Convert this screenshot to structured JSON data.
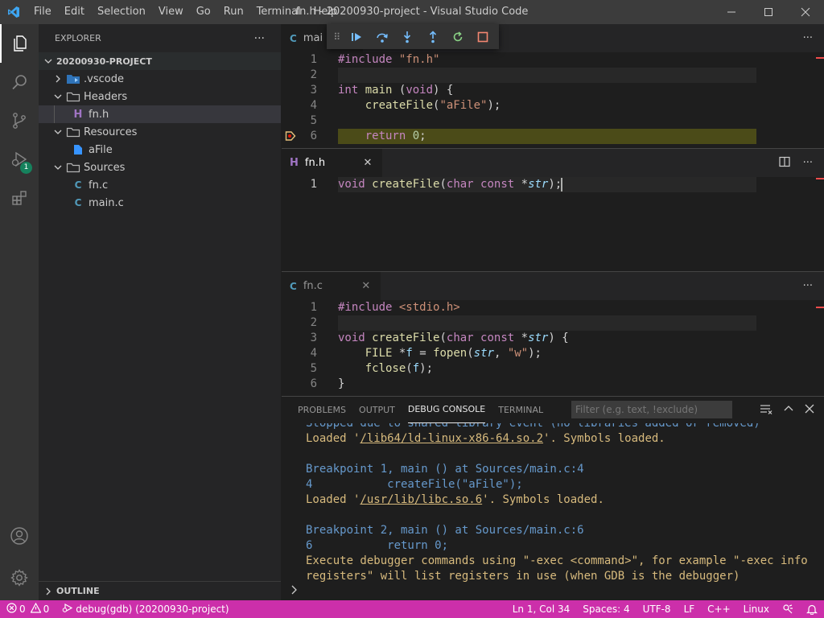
{
  "titlebar": {
    "menu": [
      "File",
      "Edit",
      "Selection",
      "View",
      "Go",
      "Run",
      "Terminal",
      "Help"
    ],
    "title": "fn.h - 20200930-project - Visual Studio Code"
  },
  "activity": {
    "debug_badge": "1"
  },
  "sidebar": {
    "header": "EXPLORER",
    "section": "20200930-PROJECT",
    "items": [
      {
        "label": ".vscode"
      },
      {
        "label": "Headers"
      },
      {
        "label": "fn.h"
      },
      {
        "label": "Resources"
      },
      {
        "label": "aFile"
      },
      {
        "label": "Sources"
      },
      {
        "label": "fn.c"
      },
      {
        "label": "main.c"
      }
    ],
    "outline": "OUTLINE"
  },
  "editor1": {
    "tab": "mai"
  },
  "editor2": {
    "tab": "fn.h"
  },
  "editor3": {
    "tab": "fn.c"
  },
  "panel": {
    "tabs": [
      "PROBLEMS",
      "OUTPUT",
      "DEBUG CONSOLE",
      "TERMINAL"
    ],
    "filter_placeholder": "Filter (e.g. text, !exclude)",
    "console": {
      "l0": "Stopped due to shared library event (no libraries added or removed)",
      "l1a": "Loaded '",
      "l1b": "/lib64/ld-linux-x86-64.so.2",
      "l1c": "'. Symbols loaded.",
      "l3": "Breakpoint 1, main () at Sources/main.c:4",
      "l4": "4           createFile(\"aFile\");",
      "l5a": "Loaded '",
      "l5b": "/usr/lib/libc.so.6",
      "l5c": "'. Symbols loaded.",
      "l7": "Breakpoint 2, main () at Sources/main.c:6",
      "l8": "6           return 0;",
      "l9": "Execute debugger commands using \"-exec <command>\", for example \"-exec info",
      "l10": "registers\" will list registers in use (when GDB is the debugger)"
    }
  },
  "statusbar": {
    "errors": "0",
    "warnings": "0",
    "debug": "debug(gdb) (20200930-project)",
    "position": "Ln 1, Col 34",
    "spaces": "Spaces: 4",
    "encoding": "UTF-8",
    "eol": "LF",
    "language": "C++",
    "platform": "Linux"
  },
  "colors": {
    "statusbar": "#cc2faa",
    "accent": "#007acc",
    "debug_line": "#4b4b18"
  }
}
